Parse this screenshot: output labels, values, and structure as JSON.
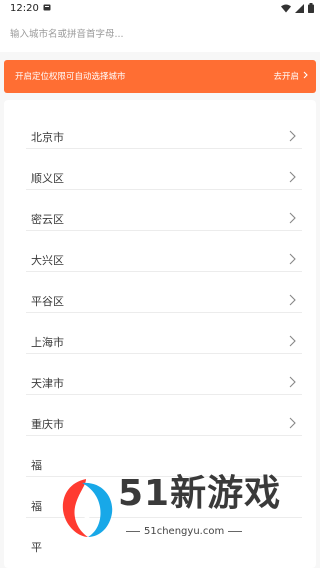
{
  "status_bar": {
    "time": "12:20"
  },
  "search": {
    "placeholder": "输入城市名或拼音首字母..."
  },
  "banner": {
    "text": "开启定位权限可自动选择城市",
    "action": "去开启",
    "background": "#ff6e33"
  },
  "cities": [
    {
      "label": "北京市"
    },
    {
      "label": "顺义区"
    },
    {
      "label": "密云区"
    },
    {
      "label": "大兴区"
    },
    {
      "label": "平谷区"
    },
    {
      "label": "上海市"
    },
    {
      "label": "天津市"
    },
    {
      "label": "重庆市"
    },
    {
      "label": "福"
    },
    {
      "label": "福"
    },
    {
      "label": "平"
    }
  ],
  "watermark": {
    "brand": "51新游戏",
    "url": "51chengyu.com"
  },
  "icons": {
    "notification": "notification-icon",
    "wifi": "wifi-icon",
    "signal": "signal-icon",
    "battery": "battery-icon",
    "chevron": "chevron-right-icon"
  }
}
